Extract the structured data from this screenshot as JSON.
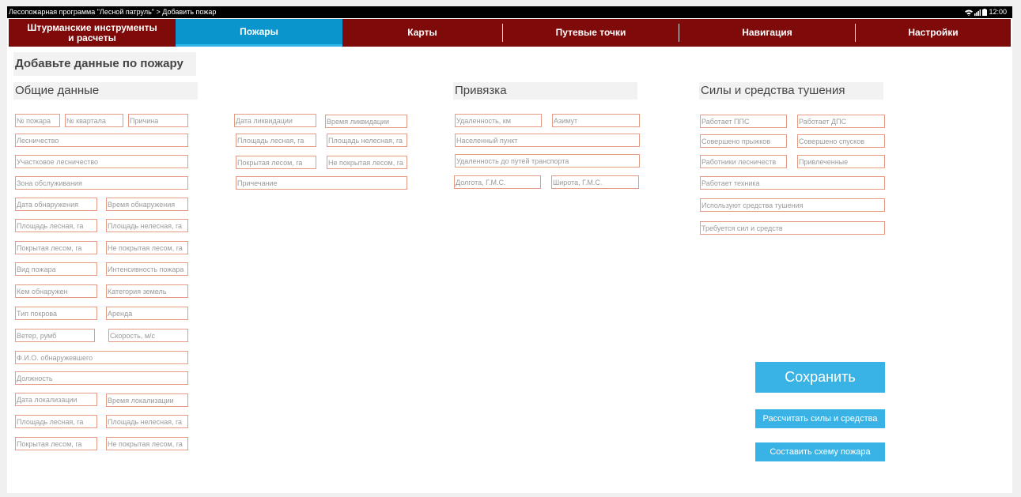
{
  "status_bar": {
    "title": "Лесопожарная программа \"Лесной патруль\" > Добавить пожар",
    "clock": "12:00",
    "icons": [
      "wifi-icon",
      "signal-icon",
      "battery-icon"
    ]
  },
  "nav": {
    "tabs": [
      {
        "label_line1": "Штурманские инструменты",
        "label_line2": "и расчеты"
      },
      {
        "label": "Пожары"
      },
      {
        "label": "Карты"
      },
      {
        "label": "Путевые точки"
      },
      {
        "label": "Навигация"
      },
      {
        "label": "Настройки"
      }
    ],
    "active_tab": "Пожары"
  },
  "page_title": "Добавьте данные по пожару",
  "sections": {
    "general": "Общие данные",
    "binding": "Привязка",
    "forces": "Силы и средства тушения"
  },
  "fields": {
    "fire_number": "№ пожара",
    "quarter_number": "№ квартала",
    "cause": "Причина",
    "forestry": "Лесничество",
    "district_forestry": "Участковое лесничество",
    "service_zone": "Зона обслуживания",
    "detection_date": "Дата обнаружения",
    "detection_time": "Время обнаружения",
    "det_area_forest": "Площадь лесная, га",
    "det_area_nonforest": "Площадь нелесная, га",
    "det_area_covered": "Покрытая лесом, га",
    "det_area_uncovered": "Не покрытая лесом, га",
    "fire_type": "Вид пожара",
    "fire_intensity": "Интенсивность пожара",
    "detected_by": "Кем обнаружен",
    "land_category": "Категория земель",
    "cover_type": "Тип покрова",
    "lease": "Аренда",
    "wind_rhumb": "Ветер, румб",
    "wind_speed": "Скорость, м/с",
    "detector_name": "Ф.И.О. обнаружевшего",
    "position": "Должность",
    "localization_date": "Дата локализации",
    "localization_time": "Время локализации",
    "loc_area_forest": "Площадь лесная, га",
    "loc_area_nonforest": "Площадь нелесная, га",
    "loc_area_covered": "Покрытая лесом, га",
    "loc_area_uncovered": "Не покрытая лесом, га",
    "liquidation_date": "Дата ликвидации",
    "liquidation_time": "Время ликвидации",
    "liq_area_forest": "Площадь лесная, га",
    "liq_area_nonforest": "Площадь нелесная, га",
    "liq_area_covered": "Покрытая лесом, га",
    "liq_area_uncovered": "Не покрытая лесом, га",
    "remark": "Причечание",
    "distance_km": "Удаленность, км",
    "azimuth": "Азимут",
    "settlement": "Населенный пункт",
    "distance_transport": "Удаленность до путей транспорта",
    "longitude": "Долгота, Г.М.С.",
    "latitude": "Широта, Г.М.С.",
    "pps_working": "Работает ППС",
    "dps_working": "Работает ДПС",
    "jumps_made": "Совершено прыжков",
    "descents_made": "Совершено спусков",
    "forestry_workers": "Работники лесничеств",
    "attracted": "Привлеченные",
    "machinery_working": "Работает техника",
    "extinguishing_means": "Используют средства тушения",
    "forces_required": "Требуется сил и средств"
  },
  "buttons": {
    "save": "Сохранить",
    "calculate": "Рассчитать силы и средства",
    "scheme": "Составить схему пожара"
  },
  "colors": {
    "nav_background": "#7f0a0a",
    "nav_active": "#0a96cc",
    "button": "#39b3e6",
    "field_border": "#e59a86"
  }
}
